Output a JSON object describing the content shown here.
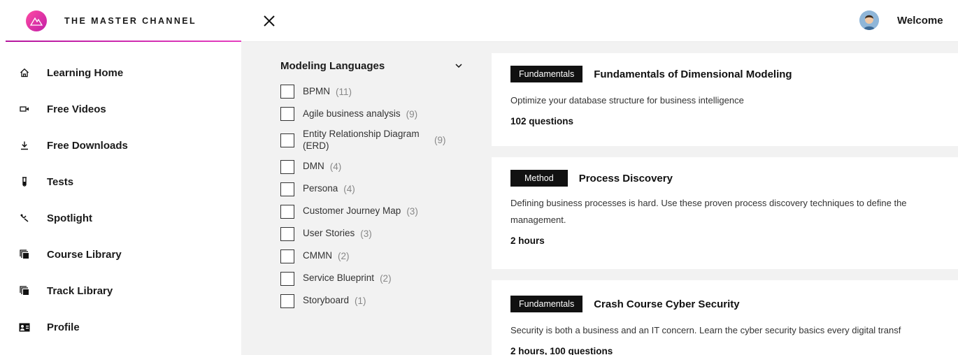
{
  "brand": {
    "name": "THE MASTER CHANNEL"
  },
  "nav": [
    {
      "label": "Learning Home",
      "icon": "home-icon"
    },
    {
      "label": "Free Videos",
      "icon": "video-camera-icon"
    },
    {
      "label": "Free Downloads",
      "icon": "download-icon"
    },
    {
      "label": "Tests",
      "icon": "test-tube-icon"
    },
    {
      "label": "Spotlight",
      "icon": "spotlight-icon"
    },
    {
      "label": "Course Library",
      "icon": "library-icon"
    },
    {
      "label": "Track Library",
      "icon": "library-icon"
    },
    {
      "label": "Profile",
      "icon": "id-card-icon"
    }
  ],
  "header": {
    "welcome": "Welcome"
  },
  "filter": {
    "title": "Modeling Languages",
    "options": [
      {
        "label": "BPMN",
        "count": "(11)"
      },
      {
        "label": "Agile business analysis",
        "count": "(9)"
      },
      {
        "label": "Entity Relationship Diagram (ERD)",
        "count": "(9)"
      },
      {
        "label": "DMN",
        "count": "(4)"
      },
      {
        "label": "Persona",
        "count": "(4)"
      },
      {
        "label": "Customer Journey Map",
        "count": "(3)"
      },
      {
        "label": "User Stories",
        "count": "(3)"
      },
      {
        "label": "CMMN",
        "count": "(2)"
      },
      {
        "label": "Service Blueprint",
        "count": "(2)"
      },
      {
        "label": "Storyboard",
        "count": "(1)"
      }
    ]
  },
  "courses": [
    {
      "tag": "Fundamentals",
      "title": "Fundamentals of Dimensional Modeling",
      "desc": [
        "Optimize your database structure for business intelligence"
      ],
      "meta": "102 questions"
    },
    {
      "tag": "Method",
      "title": "Process Discovery",
      "desc": [
        "Defining business processes is hard. Use these proven process discovery techniques to define the",
        "management."
      ],
      "meta": "2 hours"
    },
    {
      "tag": "Fundamentals",
      "title": "Crash Course Cyber Security",
      "desc": [
        "Security is both a business and an IT concern. Learn the cyber security basics every digital transf"
      ],
      "meta": "2 hours, 100 questions"
    }
  ],
  "colors": {
    "accent": "#c11fa8",
    "tag_bg": "#111111",
    "panel_bg": "#f2f2f2"
  }
}
